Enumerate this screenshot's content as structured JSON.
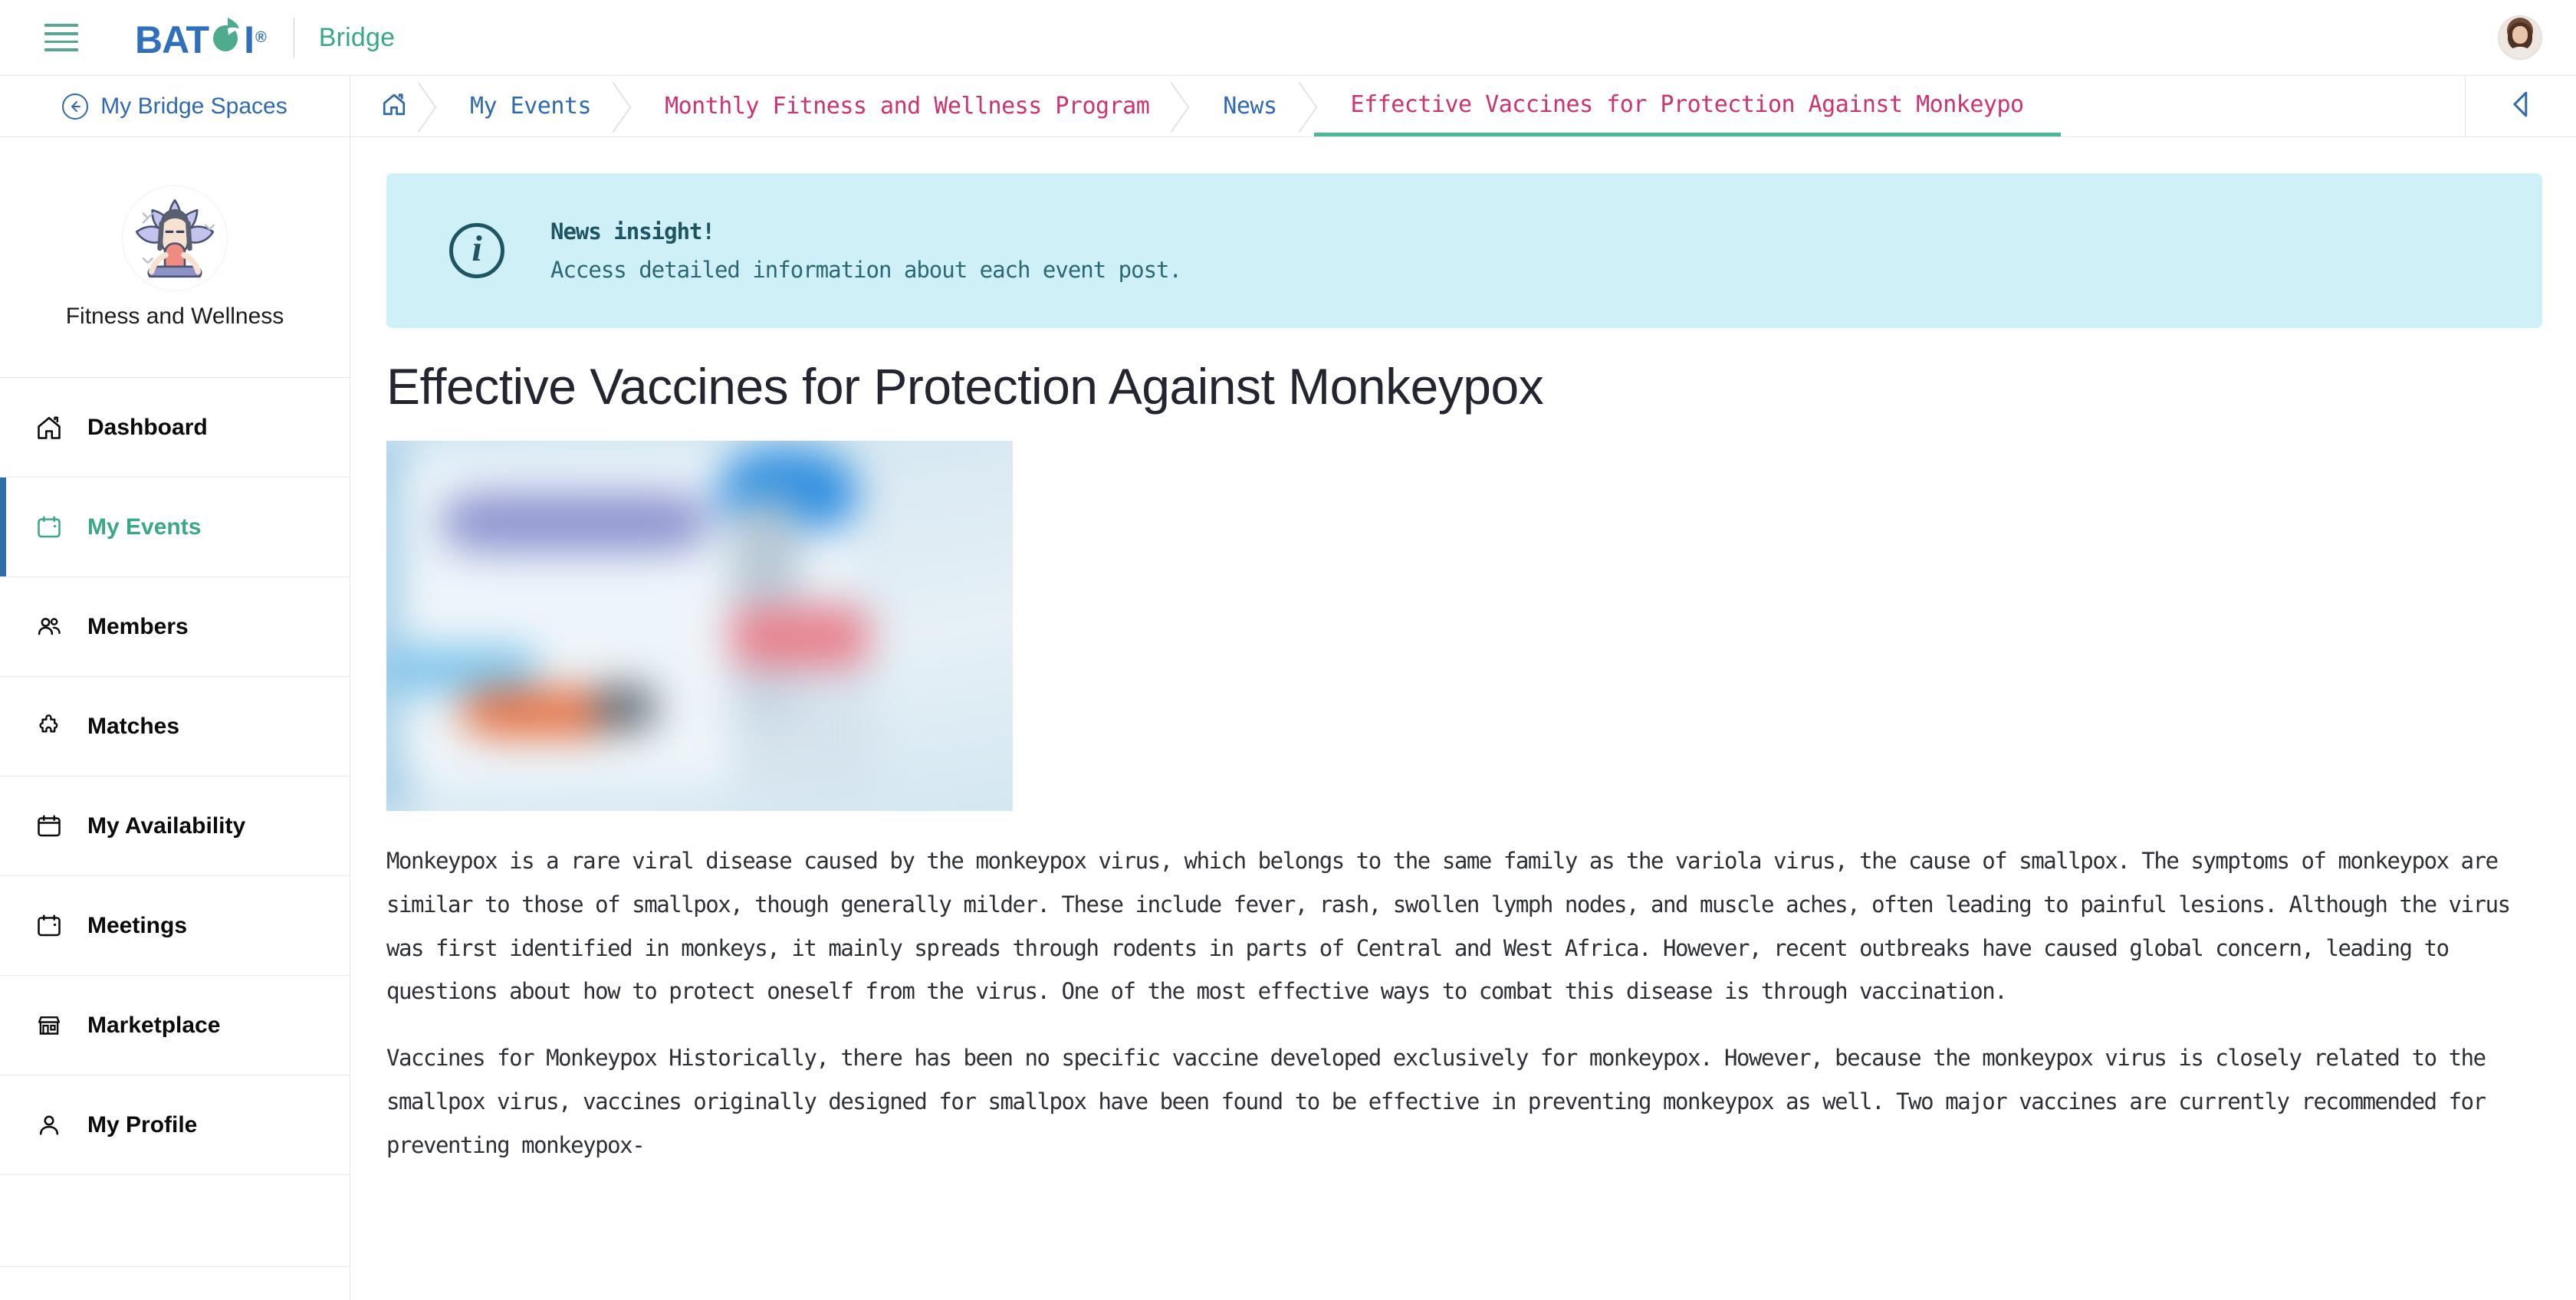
{
  "topbar": {
    "menu_icon": "hamburger-icon",
    "brand": "BATOI",
    "brand_registered": "®",
    "brand_sub": "Bridge",
    "avatar_icon": "user-avatar"
  },
  "secondbar": {
    "back_label": "My Bridge Spaces",
    "back_icon": "arrow-left-circle-icon",
    "collapse_icon": "chevron-left-icon"
  },
  "breadcrumb": {
    "home_icon": "home-icon",
    "items": [
      {
        "label": "My Events",
        "color": "blue",
        "active": false
      },
      {
        "label": "Monthly Fitness and Wellness Program",
        "color": "pink",
        "active": false
      },
      {
        "label": "News",
        "color": "blue",
        "active": false
      },
      {
        "label": "Effective Vaccines for Protection Against Monkeypo",
        "color": "pink",
        "active": true
      }
    ]
  },
  "sidebar": {
    "space_name": "Fitness and Wellness",
    "space_avatar_icon": "yoga-lotus-avatar",
    "items": [
      {
        "label": "Dashboard",
        "icon": "home-icon",
        "active": false
      },
      {
        "label": "My Events",
        "icon": "calendar-icon",
        "active": true
      },
      {
        "label": "Members",
        "icon": "users-icon",
        "active": false
      },
      {
        "label": "Matches",
        "icon": "puzzle-icon",
        "active": false
      },
      {
        "label": "My Availability",
        "icon": "calendar-icon",
        "active": false
      },
      {
        "label": "Meetings",
        "icon": "calendar-icon",
        "active": false
      },
      {
        "label": "Marketplace",
        "icon": "store-icon",
        "active": false
      },
      {
        "label": "My Profile",
        "icon": "person-icon",
        "active": false
      }
    ]
  },
  "main": {
    "insight": {
      "icon": "info-circle-icon",
      "title": "News insight!",
      "subtitle": "Access detailed information about each event post."
    },
    "article": {
      "title": "Effective Vaccines for Protection Against Monkeypox",
      "image_icon": "vaccine-photo-blurred",
      "paragraph_1": "Monkeypox is a rare viral disease caused by the monkeypox virus, which belongs to the same family as the variola virus, the cause of smallpox. The symptoms of monkeypox are similar to those of smallpox, though generally milder. These include fever, rash, swollen lymph nodes, and muscle aches, often leading to painful lesions. Although the virus was first identified in monkeys, it mainly spreads through rodents in parts of Central and West Africa. However, recent outbreaks have caused global concern, leading to questions about how to protect oneself from the virus. One of the most effective ways to combat this disease is through vaccination.",
      "paragraph_2": "Vaccines for Monkeypox Historically, there has been no specific vaccine developed exclusively for monkeypox. However, because the monkeypox virus is closely related to the smallpox virus, vaccines originally designed for smallpox have been found to be effective in preventing monkeypox as well. Two major vaccines are currently recommended for preventing monkeypox-"
    }
  },
  "colors": {
    "brand_blue": "#2f6fbb",
    "brand_green": "#3aa884",
    "crumb_blue": "#2f6ab0",
    "crumb_pink": "#cb3373",
    "active_underline": "#4db79a",
    "insight_bg": "#cff0f7",
    "insight_fg": "#1d5564",
    "sidebar_active_bar": "#2f6fa8"
  }
}
